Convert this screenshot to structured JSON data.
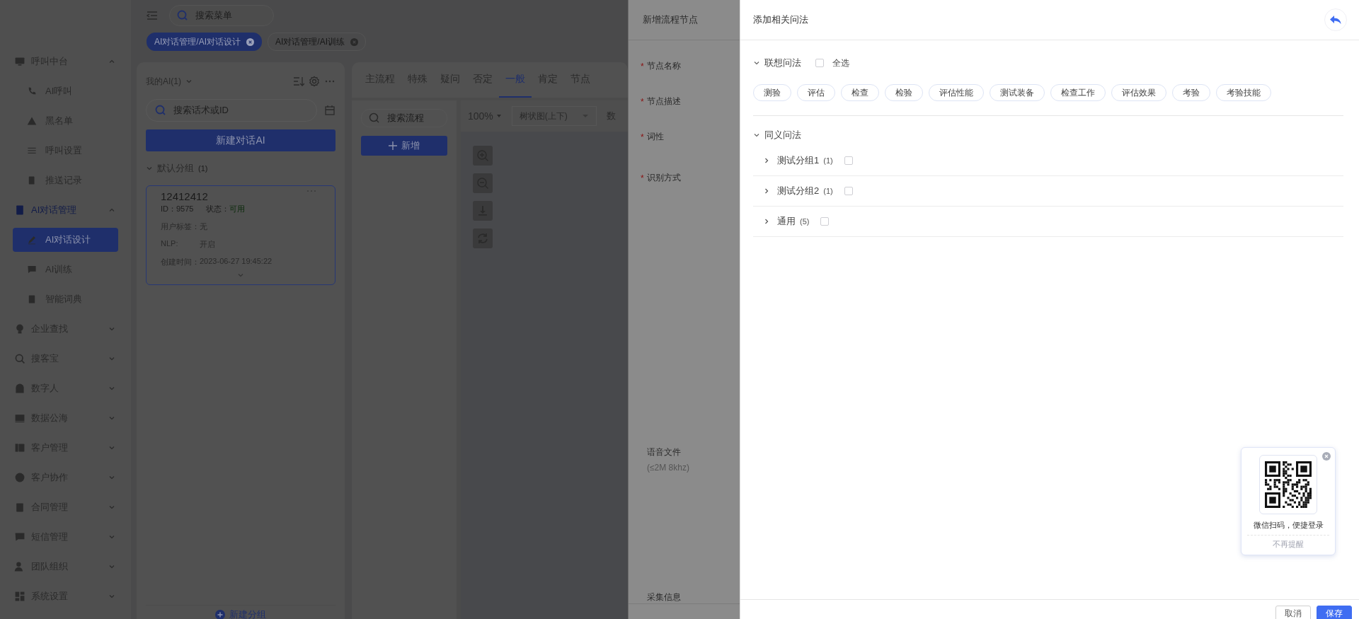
{
  "sidebar": {
    "items": [
      {
        "label": "呼叫中台",
        "expanded": true,
        "selected": false,
        "children": [
          {
            "label": "AI呼叫",
            "selected": false
          },
          {
            "label": "黑名单",
            "selected": false
          },
          {
            "label": "呼叫设置",
            "selected": false
          },
          {
            "label": "推送记录",
            "selected": false
          }
        ]
      },
      {
        "label": "AI对话管理",
        "expanded": true,
        "selected": true,
        "children": [
          {
            "label": "AI对话设计",
            "selected": true
          },
          {
            "label": "AI训练",
            "selected": false
          },
          {
            "label": "智能词典",
            "selected": false
          }
        ]
      },
      {
        "label": "企业查找",
        "expanded": false,
        "selected": false
      },
      {
        "label": "搜客宝",
        "expanded": false,
        "selected": false
      },
      {
        "label": "数字人",
        "expanded": false,
        "selected": false
      },
      {
        "label": "数据公海",
        "expanded": false,
        "selected": false
      },
      {
        "label": "客户管理",
        "expanded": false,
        "selected": false
      },
      {
        "label": "客户协作",
        "expanded": false,
        "selected": false
      },
      {
        "label": "合同管理",
        "expanded": false,
        "selected": false
      },
      {
        "label": "短信管理",
        "expanded": false,
        "selected": false
      },
      {
        "label": "团队组织",
        "expanded": false,
        "selected": false
      },
      {
        "label": "系统设置",
        "expanded": false,
        "selected": false
      }
    ]
  },
  "menu_search": {
    "placeholder": "搜索菜单"
  },
  "page_tabs": [
    {
      "label": "AI对话管理/AI对话设计",
      "selected": true
    },
    {
      "label": "AI对话管理/AI训练",
      "selected": false
    }
  ],
  "ai_panel": {
    "title": "我的AI(1)",
    "search": {
      "placeholder": "搜索话术或ID"
    },
    "new_button": "新建对话AI",
    "group": {
      "label": "默认分组",
      "count": "(1)",
      "expanded": true
    },
    "card": {
      "name": "12412412",
      "id": "ID：9575",
      "status_label": "状态：",
      "status": "可用",
      "fields": [
        {
          "label": "用户标签：",
          "value": "无"
        },
        {
          "label": "NLP:",
          "value": "开启"
        },
        {
          "label": "创建时间：",
          "value": "2023-06-27 19:45:22"
        }
      ]
    },
    "footer_button": "新建分组"
  },
  "flow_panel": {
    "tabs": [
      {
        "label": "主流程",
        "selected": false
      },
      {
        "label": "特殊",
        "selected": false
      },
      {
        "label": "疑问",
        "selected": false
      },
      {
        "label": "否定",
        "selected": false
      },
      {
        "label": "一般",
        "selected": true
      },
      {
        "label": "肯定",
        "selected": false
      },
      {
        "label": "节点",
        "selected": false
      }
    ],
    "search": {
      "placeholder": "搜索流程"
    },
    "add_button": "新增",
    "zoom": "100%",
    "layout_select": "树状图(上下)",
    "toolbar_label": "数"
  },
  "node_form": {
    "title": "新增流程节点",
    "required_mark": "*",
    "fields": [
      {
        "label": "节点名称",
        "required": true
      },
      {
        "label": "节点描述",
        "required": true
      },
      {
        "label": "词性",
        "required": true
      },
      {
        "label": "识别方式",
        "required": true
      },
      {
        "label": "语音文件",
        "note": "(≤2M 8khz)",
        "required": false
      },
      {
        "label": "采集信息",
        "required": false
      }
    ]
  },
  "related_panel": {
    "title": "添加相关问法",
    "associative": {
      "label": "联想问法",
      "expanded": true,
      "select_all": {
        "label": "全选",
        "checked": false
      },
      "tags": [
        "测验",
        "评估",
        "检查",
        "检验",
        "评估性能",
        "测试装备",
        "检查工作",
        "评估效果",
        "考验",
        "考验技能"
      ]
    },
    "synonym": {
      "label": "同义问法",
      "expanded": true,
      "groups": [
        {
          "name": "测试分组1",
          "count": "(1)",
          "checked": false,
          "expanded": false
        },
        {
          "name": "测试分组2",
          "count": "(1)",
          "checked": false,
          "expanded": false
        },
        {
          "name": "通用",
          "count": "(5)",
          "checked": false,
          "expanded": false
        }
      ]
    },
    "buttons": [
      "取消",
      "保存"
    ]
  },
  "qr_popup": {
    "caption": "微信扫码，便捷登录",
    "dismiss": "不再提醒"
  }
}
